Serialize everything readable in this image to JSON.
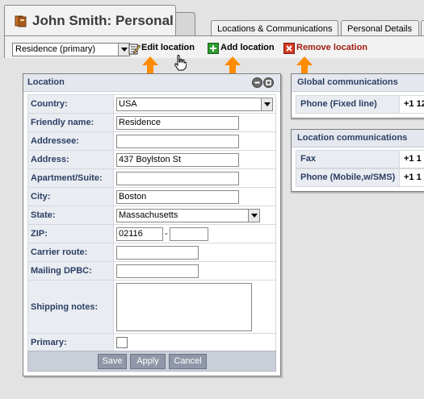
{
  "header": {
    "title": "John Smith: Personal",
    "icon": "address-book-icon"
  },
  "tabs": [
    {
      "label": "Locations & Communications"
    },
    {
      "label": "Personal Details"
    }
  ],
  "toolbar": {
    "location_select": "Residence (primary)",
    "edit_location": "Edit location",
    "add_location": "Add location",
    "remove_location": "Remove location"
  },
  "location_panel": {
    "title": "Location",
    "fields": {
      "country": {
        "label": "Country:",
        "value": "USA"
      },
      "friendly_name": {
        "label": "Friendly name:",
        "value": "Residence"
      },
      "addressee": {
        "label": "Addressee:",
        "value": ""
      },
      "address": {
        "label": "Address:",
        "value": "437 Boylston St"
      },
      "apartment": {
        "label": "Apartment/Suite:",
        "value": ""
      },
      "city": {
        "label": "City:",
        "value": "Boston"
      },
      "state": {
        "label": "State:",
        "value": "Massachusetts"
      },
      "zip": {
        "label": "ZIP:",
        "value": "02116",
        "ext": "",
        "separator": "-"
      },
      "carrier_route": {
        "label": "Carrier route:",
        "value": ""
      },
      "mailing_dpbc": {
        "label": "Mailing DPBC:",
        "value": ""
      },
      "shipping_notes": {
        "label": "Shipping notes:",
        "value": ""
      },
      "primary": {
        "label": "Primary:",
        "checked": false
      }
    },
    "buttons": {
      "save": "Save",
      "apply": "Apply",
      "cancel": "Cancel"
    }
  },
  "global_communications": {
    "title": "Global communications",
    "rows": [
      {
        "label": "Phone (Fixed line)",
        "value": "+1 12"
      }
    ]
  },
  "location_communications": {
    "title": "Location communications",
    "rows": [
      {
        "label": "Fax",
        "value": "+1 1"
      },
      {
        "label": "Phone (Mobile,w/SMS)",
        "value": "+1 1"
      }
    ]
  },
  "colors": {
    "accent_arrow": "#ff8c00",
    "label_text": "#2c3e64",
    "panel_header": "#e4e8ee",
    "button_bg": "#8f97a8"
  }
}
